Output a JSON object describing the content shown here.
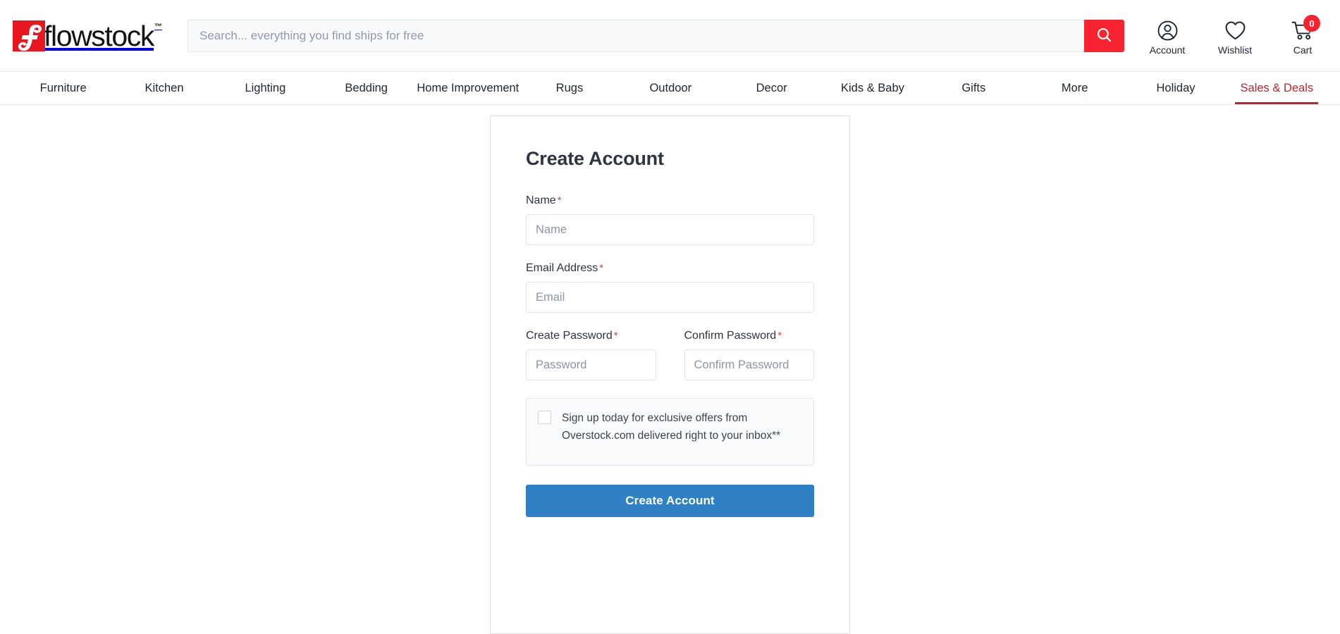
{
  "brand": {
    "logo_word": "flowstock",
    "logo_tm": "™",
    "logo_mark_color": "#e8161e",
    "accent_red": "#f7232f",
    "sale_red": "#c4202e",
    "primary_blue": "#2f80c5"
  },
  "search": {
    "placeholder": "Search... everything you find ships for free",
    "value": "",
    "button_icon": "search-icon"
  },
  "header_actions": [
    {
      "icon": "account-icon",
      "label": "Account"
    },
    {
      "icon": "heart-icon",
      "label": "Wishlist"
    },
    {
      "icon": "cart-icon",
      "label": "Cart",
      "badge": "0"
    }
  ],
  "nav": {
    "items": [
      {
        "label": "Furniture",
        "active": false
      },
      {
        "label": "Kitchen",
        "active": false
      },
      {
        "label": "Lighting",
        "active": false
      },
      {
        "label": "Bedding",
        "active": false
      },
      {
        "label": "Home Improvement",
        "active": false
      },
      {
        "label": "Rugs",
        "active": false
      },
      {
        "label": "Outdoor",
        "active": false
      },
      {
        "label": "Decor",
        "active": false
      },
      {
        "label": "Kids & Baby",
        "active": false
      },
      {
        "label": "Gifts",
        "active": false
      },
      {
        "label": "More",
        "active": false
      },
      {
        "label": "Holiday",
        "active": false
      },
      {
        "label": "Sales & Deals",
        "active": true
      }
    ]
  },
  "form": {
    "title": "Create Account",
    "name": {
      "label": "Name",
      "required_mark": "*",
      "placeholder": "Name",
      "value": ""
    },
    "email": {
      "label": "Email Address",
      "required_mark": "*",
      "placeholder": "Email",
      "value": ""
    },
    "password": {
      "label": "Create Password",
      "required_mark": "*",
      "placeholder": "Password",
      "value": ""
    },
    "confirm_password": {
      "label": "Confirm Password",
      "required_mark": "*",
      "placeholder": "Confirm Password",
      "value": ""
    },
    "optin": {
      "checked": false,
      "text": "Sign up today for exclusive offers from Overstock.com delivered right to your inbox**"
    },
    "submit_label": "Create Account"
  }
}
